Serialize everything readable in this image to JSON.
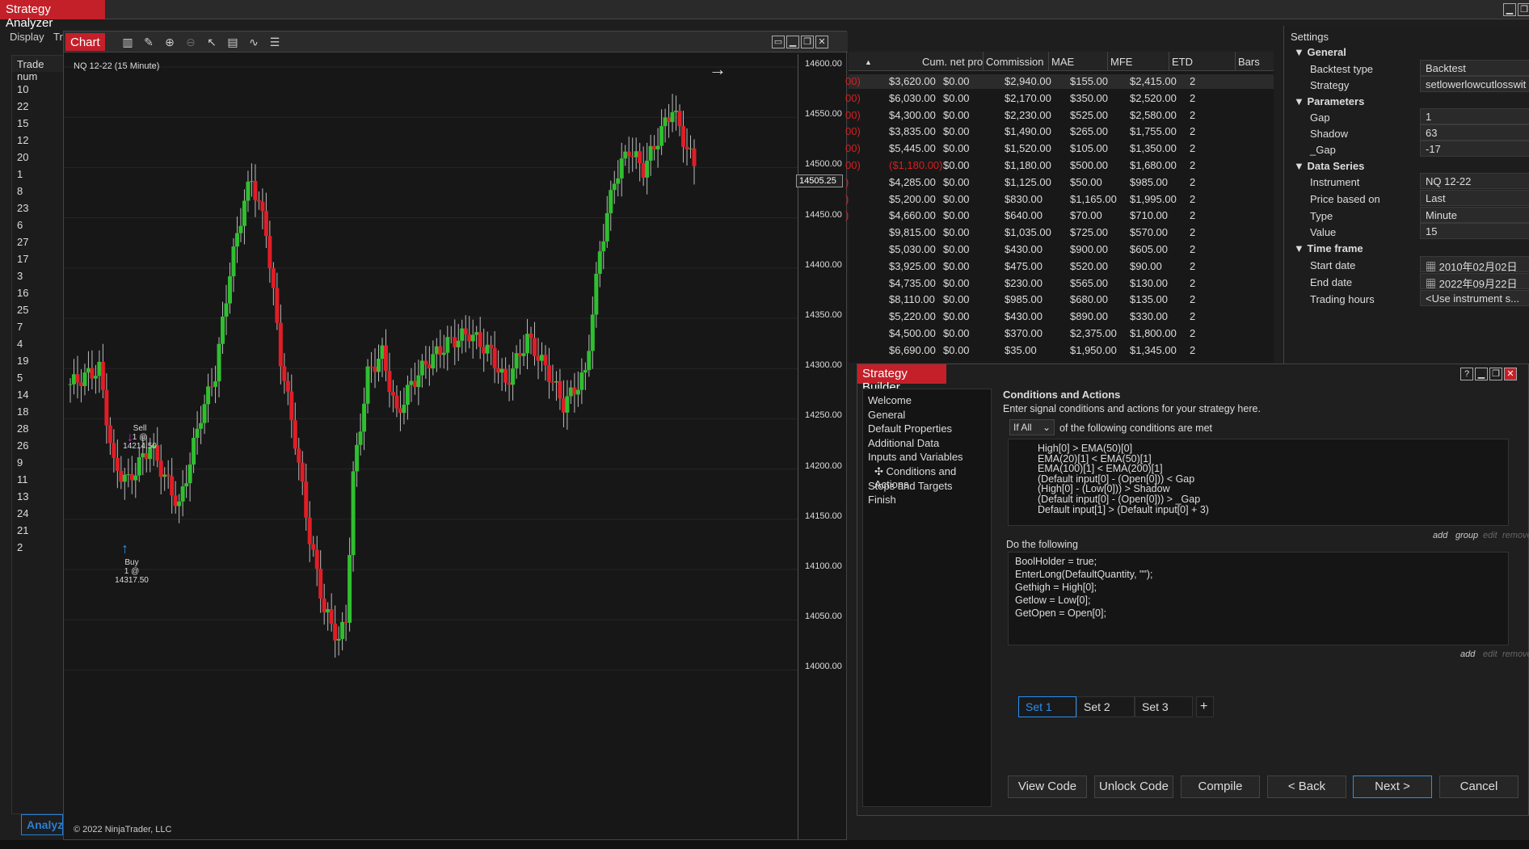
{
  "app": {
    "title": "Strategy Analyzer"
  },
  "analyzer": {
    "display_tab": "Display",
    "tr_tab": "Tr",
    "trade_header": "Trade num",
    "trade_numbers": [
      "10",
      "22",
      "15",
      "12",
      "20",
      "1",
      "8",
      "23",
      "6",
      "27",
      "17",
      "3",
      "16",
      "25",
      "7",
      "4",
      "19",
      "5",
      "14",
      "18",
      "28",
      "26",
      "9",
      "11",
      "13",
      "24",
      "21",
      "2"
    ],
    "bottom_tab": "Analyz"
  },
  "chart": {
    "tab_label": "Chart",
    "instrument_label": "NQ 12-22 (15 Minute)",
    "copyright": "© 2022 NinjaTrader, LLC",
    "current_price": "14505.25",
    "y_ticks": [
      "14600.00",
      "14550.00",
      "14500.00",
      "14450.00",
      "14400.00",
      "14350.00",
      "14300.00",
      "14250.00",
      "14200.00",
      "14150.00",
      "14100.00",
      "14050.00",
      "14000.00"
    ],
    "sell_label": "Sell",
    "sell_detail": "1 @ 14214.50",
    "buy_label": "Buy",
    "buy_detail": "1 @ 14317.50",
    "colors": {
      "up": "#2fbf2f",
      "down": "#e11d26",
      "background": "#171717"
    }
  },
  "grid": {
    "headers": [
      "Cum. net pro",
      "Commission",
      "MAE",
      "MFE",
      "ETD",
      "Bars"
    ],
    "rows": [
      [
        "00)",
        "$3,620.00",
        "$0.00",
        "$2,940.00",
        "$155.00",
        "$2,415.00",
        "2"
      ],
      [
        "00)",
        "$6,030.00",
        "$0.00",
        "$2,170.00",
        "$350.00",
        "$2,520.00",
        "2"
      ],
      [
        "00)",
        "$4,300.00",
        "$0.00",
        "$2,230.00",
        "$525.00",
        "$2,580.00",
        "2"
      ],
      [
        "00)",
        "$3,835.00",
        "$0.00",
        "$1,490.00",
        "$265.00",
        "$1,755.00",
        "2"
      ],
      [
        "00)",
        "$5,445.00",
        "$0.00",
        "$1,520.00",
        "$105.00",
        "$1,350.00",
        "2"
      ],
      [
        "00)",
        "($1,180.00)",
        "$0.00",
        "$1,180.00",
        "$500.00",
        "$1,680.00",
        "2"
      ],
      [
        ")",
        "$4,285.00",
        "$0.00",
        "$1,125.00",
        "$50.00",
        "$985.00",
        "2"
      ],
      [
        ")",
        "$5,200.00",
        "$0.00",
        "$830.00",
        "$1,165.00",
        "$1,995.00",
        "2"
      ],
      [
        ")",
        "$4,660.00",
        "$0.00",
        "$640.00",
        "$70.00",
        "$710.00",
        "2"
      ],
      [
        "",
        "$9,815.00",
        "$0.00",
        "$1,035.00",
        "$725.00",
        "$570.00",
        "2"
      ],
      [
        "",
        "$5,030.00",
        "$0.00",
        "$430.00",
        "$900.00",
        "$605.00",
        "2"
      ],
      [
        "",
        "$3,925.00",
        "$0.00",
        "$475.00",
        "$520.00",
        "$90.00",
        "2"
      ],
      [
        "",
        "$4,735.00",
        "$0.00",
        "$230.00",
        "$565.00",
        "$130.00",
        "2"
      ],
      [
        "",
        "$8,110.00",
        "$0.00",
        "$985.00",
        "$680.00",
        "$135.00",
        "2"
      ],
      [
        "",
        "$5,220.00",
        "$0.00",
        "$430.00",
        "$890.00",
        "$330.00",
        "2"
      ],
      [
        "",
        "$4,500.00",
        "$0.00",
        "$370.00",
        "$2,375.00",
        "$1,800.00",
        "2"
      ],
      [
        "",
        "$6,690.00",
        "$0.00",
        "$35.00",
        "$1,950.00",
        "$1,345.00",
        "2"
      ]
    ]
  },
  "settings": {
    "title": "Settings",
    "sections": {
      "general": "General",
      "parameters": "Parameters",
      "data_series": "Data Series",
      "time_frame": "Time frame"
    },
    "backtest_type_label": "Backtest type",
    "backtest_type": "Backtest",
    "strategy_label": "Strategy",
    "strategy": "setlowerlowcutlosswit",
    "gap_label": "Gap",
    "gap": "1",
    "shadow_label": "Shadow",
    "shadow": "63",
    "ugap_label": "_Gap",
    "ugap": "-17",
    "instrument_label": "Instrument",
    "instrument": "NQ 12-22",
    "price_based_label": "Price based on",
    "price_based": "Last",
    "type_label": "Type",
    "type": "Minute",
    "value_label": "Value",
    "value": "15",
    "start_label": "Start date",
    "start": "2010年02月02日",
    "end_label": "End date",
    "end": "2022年09月22日",
    "hours_label": "Trading hours",
    "hours": "<Use instrument s..."
  },
  "builder": {
    "title": "Strategy Builder",
    "nav": [
      "Welcome",
      "General",
      "Default Properties",
      "Additional Data",
      "Inputs and Variables",
      "Conditions and Actions",
      "Stops and Targets",
      "Finish"
    ],
    "heading": "Conditions and Actions",
    "subtitle": "Enter signal conditions and actions for your strategy here.",
    "mode": "If All",
    "mode_suffix": "of the following conditions are met",
    "conditions": [
      "High[0] > EMA(50)[0]",
      "EMA(20)[1] < EMA(50)[1]",
      "EMA(100)[1] < EMA(200)[1]",
      "(Default input[0] - (Open[0]))  < Gap",
      "(High[0] - (Low[0]))  > Shadow",
      "(Default input[0] - (Open[0]))  > _Gap",
      "Default input[1] > (Default input[0] + 3)"
    ],
    "cond_links": {
      "add": "add",
      "group": "group",
      "edit": "edit",
      "remove": "remove"
    },
    "do_label": "Do the following",
    "actions": [
      "BoolHolder = true;",
      "EnterLong(DefaultQuantity, \"\");",
      "Gethigh = High[0];",
      "Getlow = Low[0];",
      "GetOpen = Open[0];"
    ],
    "act_links": {
      "add": "add",
      "edit": "edit",
      "remove": "remove"
    },
    "sets": [
      "Set 1",
      "Set 2",
      "Set 3"
    ],
    "plus": "+",
    "buttons": {
      "view": "View Code",
      "unlock": "Unlock Code",
      "compile": "Compile",
      "back": "< Back",
      "next": "Next >",
      "cancel": "Cancel"
    }
  }
}
